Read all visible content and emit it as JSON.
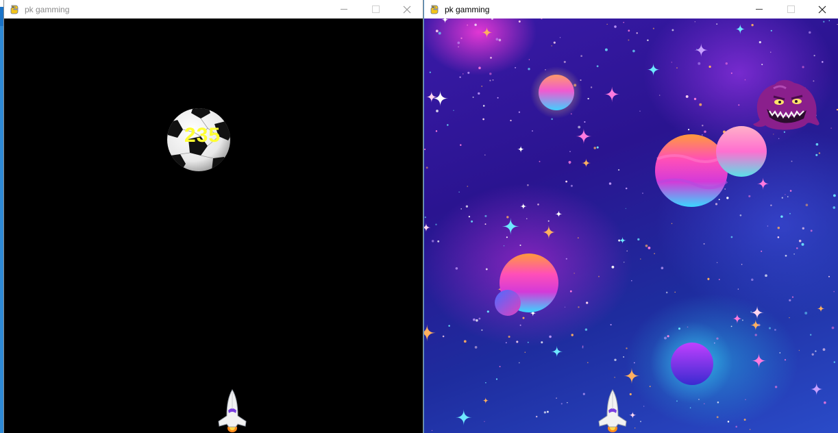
{
  "windows": [
    {
      "id": "left",
      "title": "pk gamming",
      "state": "inactive",
      "background": "#000000",
      "score": "235",
      "sprites": [
        "soccer-ball",
        "spaceship"
      ]
    },
    {
      "id": "right",
      "title": "pk gamming",
      "state": "active",
      "background": "space-nebula",
      "sprites": [
        "planets",
        "alien-monster",
        "spaceship"
      ]
    }
  ],
  "controls": {
    "minimize_icon": "minimize-icon",
    "maximize_icon": "maximize-icon",
    "close_icon": "close-icon"
  },
  "colors": {
    "score_text": "#ffff33",
    "accent_purple": "#8a2be2"
  }
}
